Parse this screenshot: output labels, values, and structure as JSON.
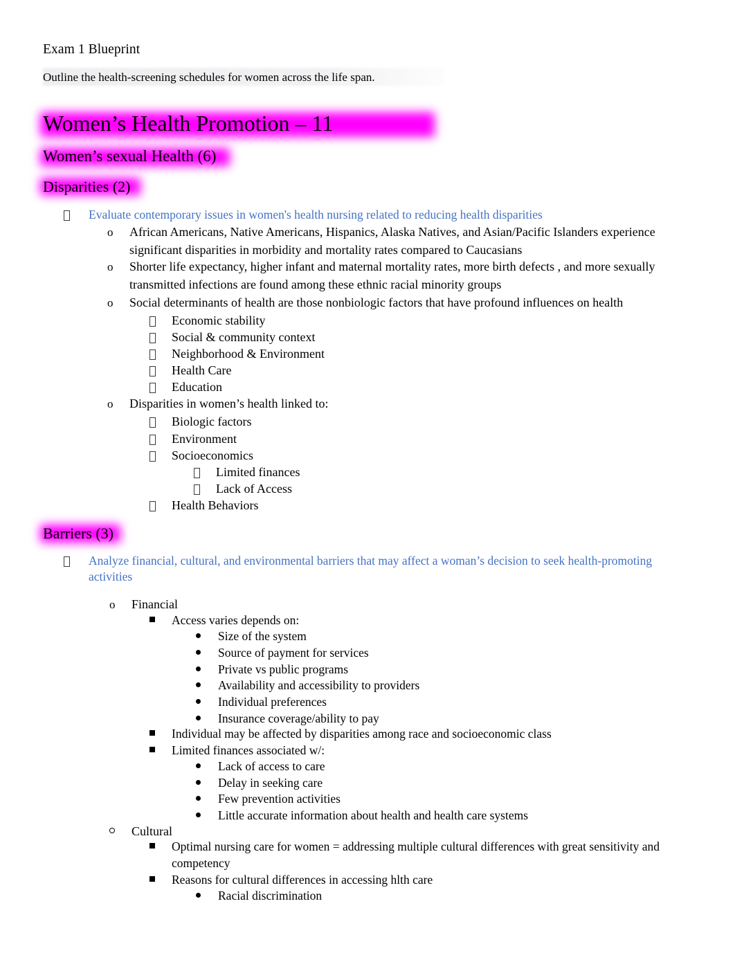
{
  "document": {
    "title": "Exam 1 Blueprint",
    "lead_line": "Outline the health-screening schedules for women across the life span."
  },
  "colors": {
    "highlight": "#FF00FF",
    "objective_text": "#4472C4",
    "body_text": "#000000",
    "shading": "#ECECEE"
  },
  "headings": {
    "h1_promotion": "Women’s Health Promotion – 11",
    "h2_sexual_health": "Women’s sexual Health (6)",
    "h3_disparities": "Disparities (2)",
    "h3_barriers": "Barriers (3)"
  },
  "disparities": {
    "objective": "Evaluate contemporary issues in women's health nursing related to reducing health disparities",
    "points": [
      "African Americans, Native Americans, Hispanics, Alaska Natives, and Asian/Pacific Islanders experience significant disparities in morbidity  and mortality rates compared to Caucasians",
      "Shorter life expectancy, higher infant and maternal mortality rates, more   birth defects , and more sexually transmitted infections are found among these ethnic racial minority groups",
      "Social determinants of health are those nonbiologic factors that have profound influences on health",
      "Disparities in women’s health linked to:"
    ],
    "social_determinants": [
      "Economic stability",
      "Social & community context",
      "Neighborhood & Environment",
      "Health Care",
      "Education"
    ],
    "linked_to": [
      "Biologic factors",
      "Environment",
      "Socioeconomics",
      "Health Behaviors"
    ],
    "socioeconomics_sub": [
      "Limited finances",
      "Lack of Access"
    ]
  },
  "barriers": {
    "objective": "Analyze financial, cultural, and environmental barriers that may affect a woman’s decision to seek health-promoting activities",
    "financial": {
      "label": "Financial",
      "access_varies": "Access varies depends on:",
      "access_factors": [
        "Size of the system",
        "Source of payment for services",
        "Private vs public programs",
        "Availability and accessibility to providers",
        "Individual preferences",
        "Insurance coverage/ability to pay"
      ],
      "individual_disparities": "Individual may be affected by disparities among race and socioeconomic class",
      "limited_finances": "Limited finances associated w/:",
      "limited_finances_sub": [
        "Lack of access to care",
        "Delay in seeking care",
        "Few prevention activities",
        "Little accurate information about health and health care systems"
      ]
    },
    "cultural": {
      "label": "Cultural",
      "optimal_care": "Optimal nursing care for women = addressing multiple cultural differences with great sensitivity and competency",
      "reasons": "Reasons for cultural differences in accessing hlth care",
      "reasons_sub": [
        "Racial discrimination"
      ]
    }
  },
  "bullet_glyphs": {
    "level1": "tofu-box",
    "level2": "o",
    "level2_alt": "hollow-circle",
    "level3": "tofu-box",
    "level3_alt": "filled-square",
    "level4": "filled-disc"
  }
}
